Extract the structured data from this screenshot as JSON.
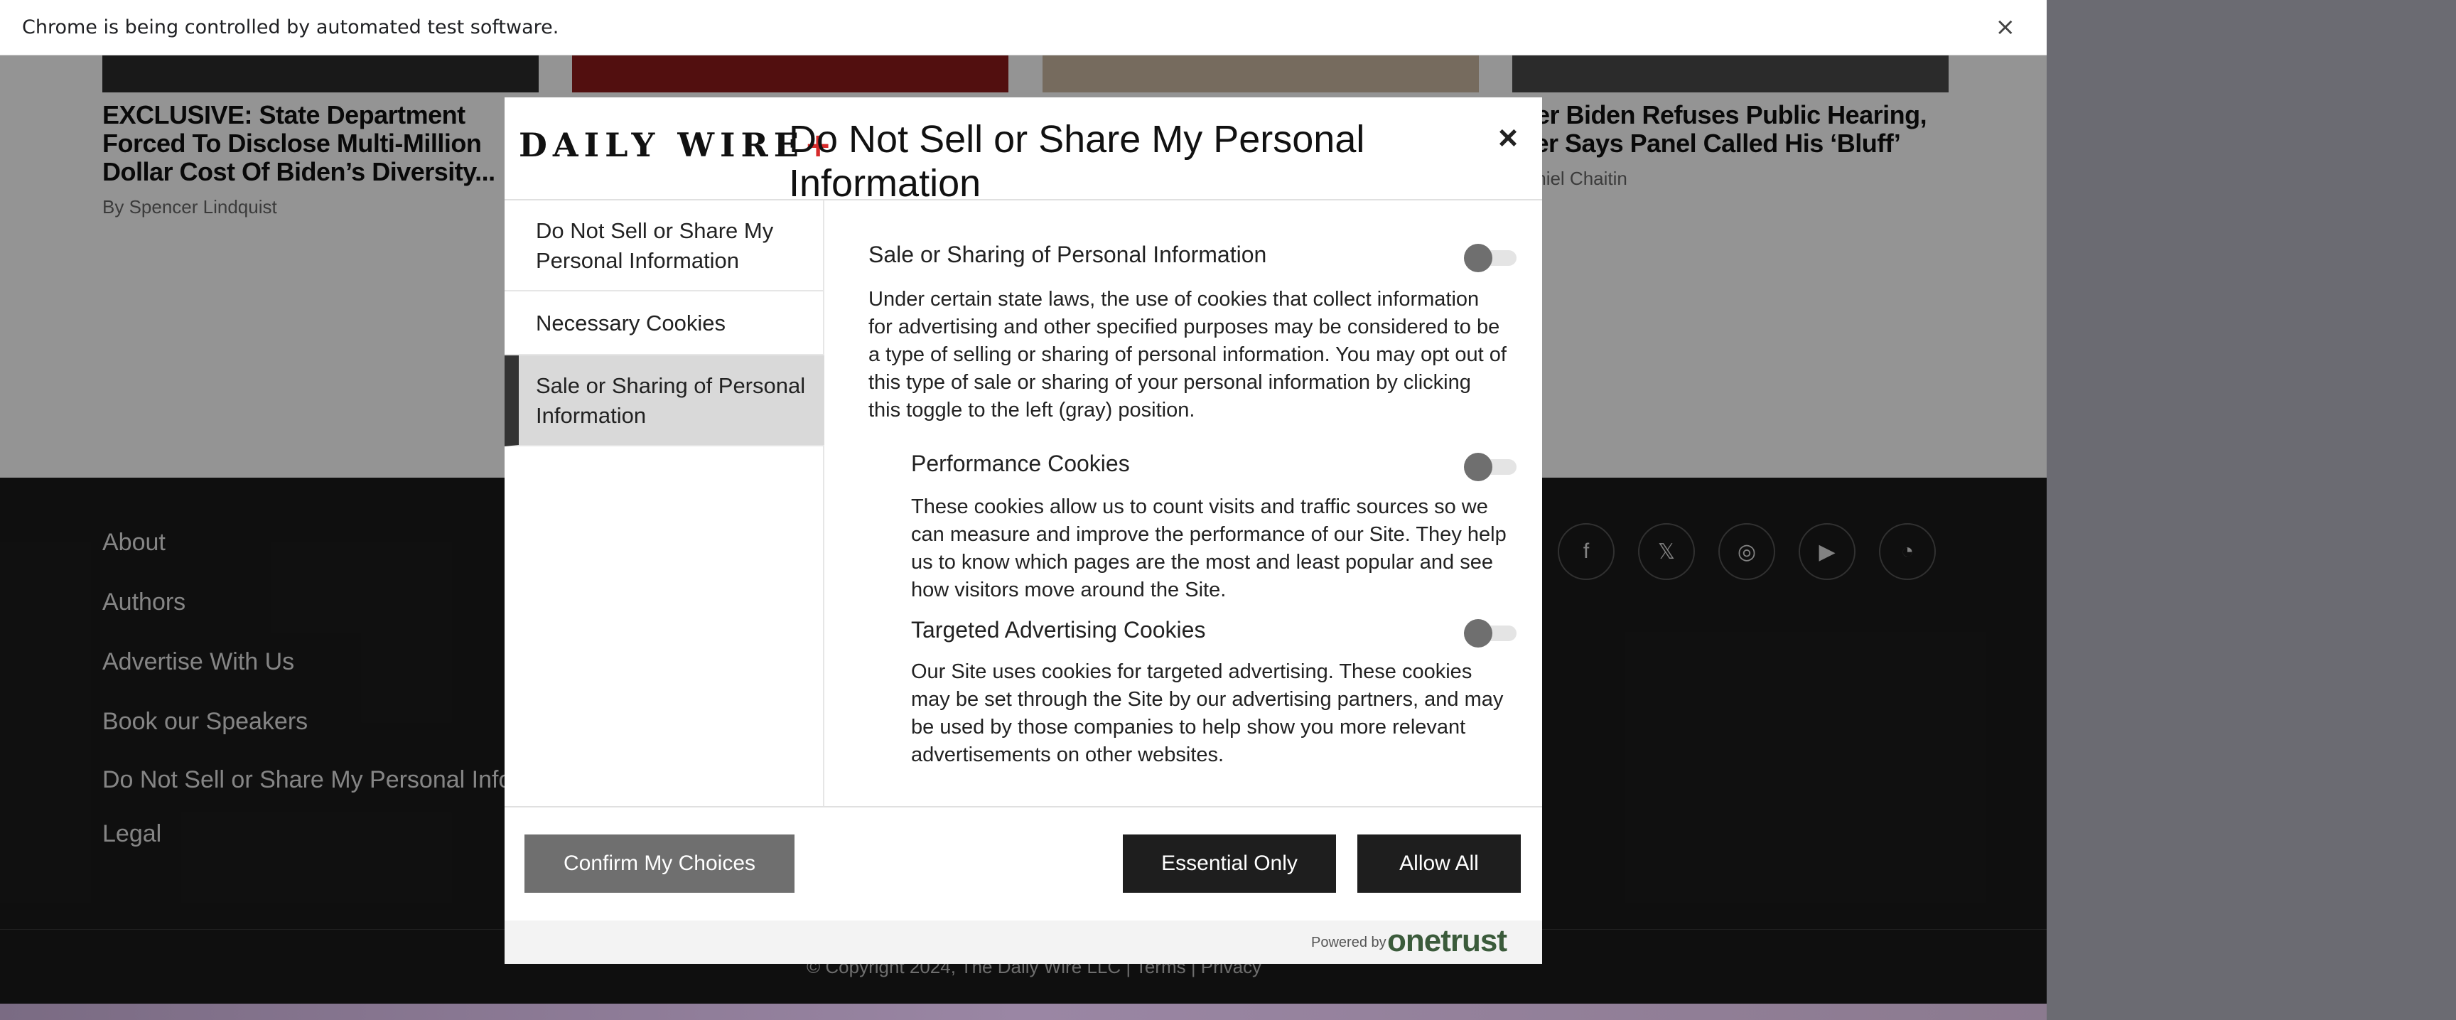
{
  "browser": {
    "infobar_text": "Chrome is being controlled by automated test software.",
    "infobar_close": "×"
  },
  "articles": [
    {
      "title": "EXCLUSIVE: State Department Forced To Disclose Multi-Million Dollar Cost Of Biden’s Diversity...",
      "author": "By Spencer Lindquist"
    },
    {
      "title": "",
      "author": ""
    },
    {
      "title": "",
      "author": ""
    },
    {
      "title": "nter Biden Refuses Public Hearing, mer Says Panel Called His ‘Bluff’",
      "author": "Daniel Chaitin"
    }
  ],
  "footer": {
    "links": [
      "About",
      "Authors",
      "Advertise With Us",
      "Book our Speakers",
      "Do Not Sell or Share My Personal Information",
      "Legal"
    ],
    "social_icons": [
      "facebook-icon",
      "x-icon",
      "instagram-icon",
      "youtube-icon",
      "rss-icon"
    ],
    "copyright": "© Copyright 2024, The Daily Wire LLC | Terms | Privacy"
  },
  "modal": {
    "logo_text": "DAILY WIRE",
    "logo_mark": "+",
    "title": "Do Not Sell or Share My Personal Information",
    "close_label": "×",
    "menu": [
      {
        "label": "Do Not Sell or Share My Personal Information",
        "active": false
      },
      {
        "label": "Necessary Cookies",
        "active": false
      },
      {
        "label": "Sale or Sharing of Personal Information",
        "active": true
      }
    ],
    "sections": [
      {
        "title": "Sale or Sharing of Personal Information",
        "description": "Under certain state laws, the use of cookies that collect information for advertising and other specified purposes may be considered to be a type of selling or sharing of personal information. You may opt out of this type of sale or sharing of your personal information by clicking this toggle to the left (gray) position.",
        "toggle_on": false
      },
      {
        "title": "Performance Cookies",
        "description": "These cookies allow us to count visits and traffic sources so we can measure and improve the performance of our Site. They help us to know which pages are the most and least popular and see how visitors move around the Site.",
        "toggle_on": false
      },
      {
        "title": "Targeted Advertising Cookies",
        "description": "Our Site uses cookies for targeted advertising. These cookies may be set through the Site by our advertising partners, and may be used by those companies to help show you more relevant advertisements on other websites.",
        "toggle_on": false
      }
    ],
    "buttons": {
      "confirm": "Confirm My Choices",
      "essential": "Essential Only",
      "allow_all": "Allow All"
    },
    "powered_by": "Powered by",
    "powered_brand": "onetrust"
  },
  "colors": {
    "footer_bg": "#1b1b1b",
    "button_dark": "#1e1e1e",
    "button_gray": "#6f6f6f",
    "logo_cross": "#d62b2b"
  }
}
